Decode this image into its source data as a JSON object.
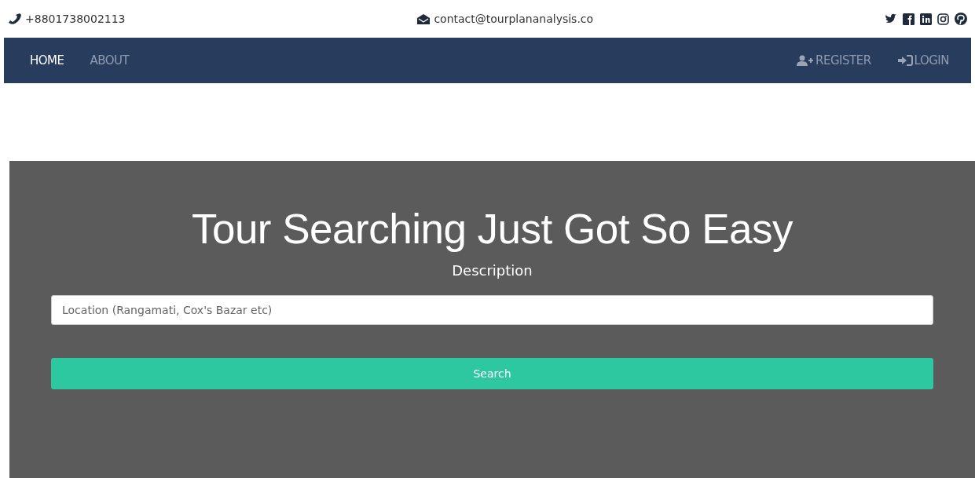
{
  "top_bar": {
    "phone": "+8801738002113",
    "email": "contact@tourplananalysis.co"
  },
  "nav": {
    "left": [
      {
        "label": "HOME",
        "selected": true
      },
      {
        "label": "ABOUT",
        "selected": false
      }
    ],
    "right": [
      {
        "label": "REGISTER",
        "kind": "register"
      },
      {
        "label": "LOGIN",
        "kind": "login"
      }
    ]
  },
  "hero": {
    "title": "Tour Searching Just Got So Easy",
    "description": "Description",
    "search": {
      "placeholder": "Location (Rangamati, Cox's Bazar etc)"
    },
    "button": "Search"
  }
}
